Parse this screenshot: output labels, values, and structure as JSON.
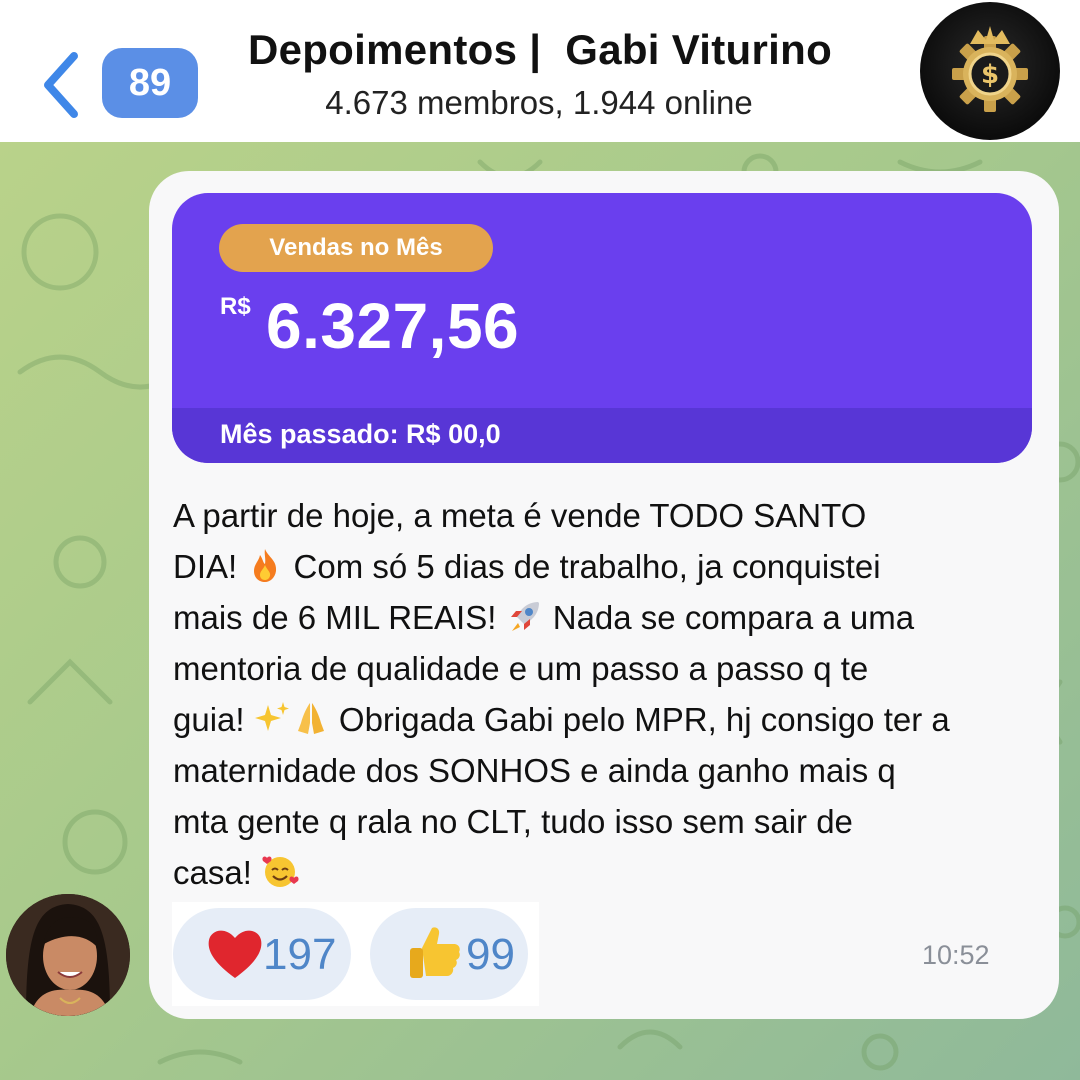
{
  "header": {
    "unread_count": "89",
    "title": "Depoimentos |  Gabi Viturino",
    "subtitle": "4.673 membros, 1.944 online"
  },
  "sales_card": {
    "label": "Vendas no Mês",
    "currency": "R$",
    "amount": "6.327,56",
    "last_month": "Mês passado: R$ 00,0"
  },
  "message": {
    "lines": [
      "A partir de hoje, a meta é vende TODO SANTO",
      "DIA!",
      "Com só 5 dias de trabalho, ja conquistei",
      "mais de 6 MIL REAIS!",
      "Nada se compara a uma",
      "mentoria de qualidade e um passo a passo q te",
      "guia!",
      "Obrigada Gabi pelo MPR, hj consigo ter a",
      "maternidade dos SONHOS e ainda ganho mais q",
      "mta gente q rala no CLT, tudo isso sem sair de",
      "casa!"
    ],
    "time": "10:52"
  },
  "reactions": [
    {
      "icon": "red-heart-icon",
      "count": "197"
    },
    {
      "icon": "thumbs-up-icon",
      "count": "99"
    }
  ],
  "colors": {
    "sales_card": "#6a3fee",
    "sales_pill": "#e3a34e",
    "badge": "#5b8fe6",
    "reaction_bg": "#e6edf7",
    "reaction_count": "#4f86c8"
  }
}
